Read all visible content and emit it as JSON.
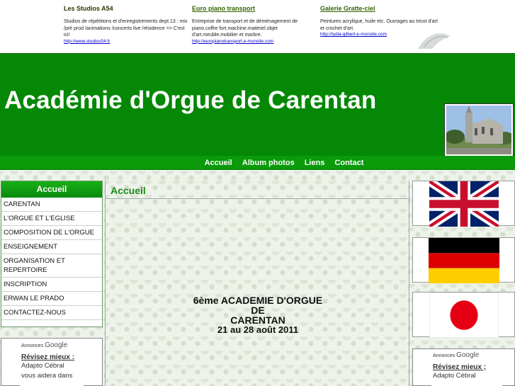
{
  "top_ads": [
    {
      "title": "Les Studios A54",
      "title_is_link": false,
      "desc": "Studios de répétitions et d'enregistrements dept.13 : mix /pré prod /animations /concerts live /résidence => C'est ici!",
      "url": "http://www.studios54.fr"
    },
    {
      "title": "Euro piano transport",
      "title_is_link": true,
      "desc": "Entreprise de transport et de déménagement de piano.coffre fort.machine.matériel.objet d'art.meuble.mobilier et marbre.",
      "url": "http://europianotransport.e-monsite.com"
    },
    {
      "title": "Galerie Gratte-ciel",
      "title_is_link": true,
      "desc": "Peintures acrylique, huile etc. Ouvrages au tricot d'art et crochet d'art.",
      "url": "http://lydia-gilbert.e-monsite.com"
    }
  ],
  "site": {
    "title": "Académie d'Orgue de Carentan",
    "header_color": "#058805",
    "nav_color": "#0a9a0a"
  },
  "nav": [
    "Accueil",
    "Album photos",
    "Liens",
    "Contact"
  ],
  "sidebar": {
    "heading": "Accueil",
    "items": [
      "CARENTAN",
      "L'ORGUE ET L'EGLISE",
      "COMPOSITION DE L'ORGUE",
      "ENSEIGNEMENT",
      "ORGANISATION ET REPERTOIRE",
      "INSCRIPTION",
      "ERWAN LE PRADO",
      "CONTACTEZ-NOUS"
    ]
  },
  "google_ads_left": {
    "label": "Annonces",
    "brand": "Google",
    "title": "Révisez mieux :",
    "lines": [
      "Adapto Cébral",
      "vous aidera dans"
    ]
  },
  "google_ads_right": {
    "label": "Annonces",
    "brand": "Google",
    "title": "Révisez mieux ;",
    "lines": [
      "Adapto Cébral"
    ]
  },
  "main": {
    "title": "Accueil",
    "title_color": "#168a16",
    "announcement": {
      "line1": "6ème ACADEMIE D'ORGUE",
      "line2": "DE",
      "line3": "CARENTAN",
      "dates": "21 au 28 août 2011"
    }
  },
  "flags": [
    {
      "name": "uk-flag-icon",
      "lang": "English"
    },
    {
      "name": "germany-flag-icon",
      "lang": "Deutsch"
    },
    {
      "name": "japan-flag-icon",
      "lang": "Japanese"
    }
  ]
}
